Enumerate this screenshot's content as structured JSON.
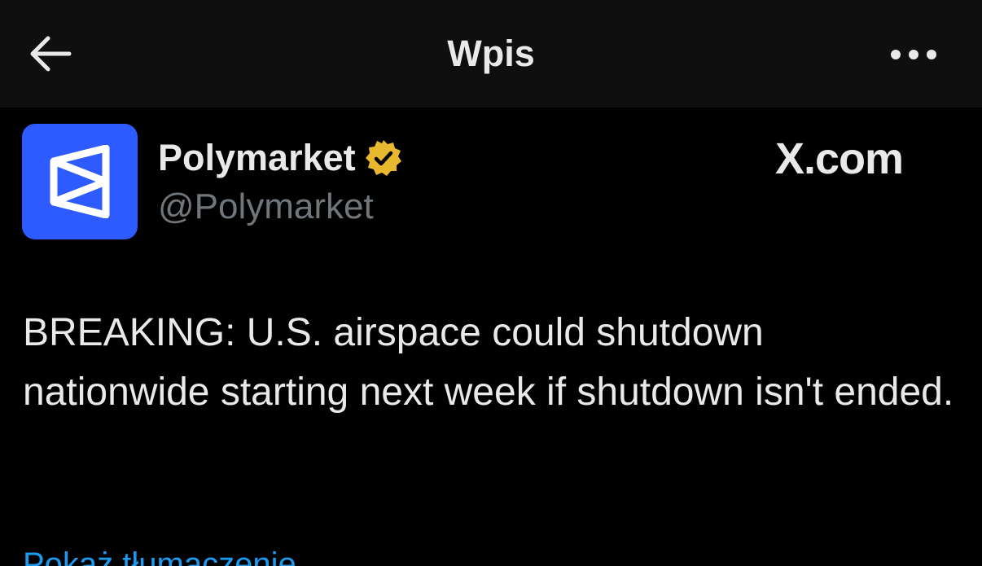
{
  "header": {
    "title": "Wpis",
    "back_icon": "arrow-left-icon",
    "more_icon": "more-horizontal-icon"
  },
  "author": {
    "name": "Polymarket",
    "handle": "@Polymarket",
    "verified": true,
    "avatar_color": "#2e5bff",
    "badge_color": "#e8b82e"
  },
  "watermark": {
    "text": "X.com"
  },
  "post": {
    "text": "BREAKING: U.S. airspace could shutdown nationwide starting next week if shutdown isn't ended."
  },
  "translate": {
    "label": "Pokaż tłumaczenie"
  },
  "colors": {
    "background": "#000000",
    "header_background": "#0f0f0f",
    "text_primary": "#e7e9ea",
    "text_secondary": "#71767b",
    "link": "#1d9bf0"
  }
}
